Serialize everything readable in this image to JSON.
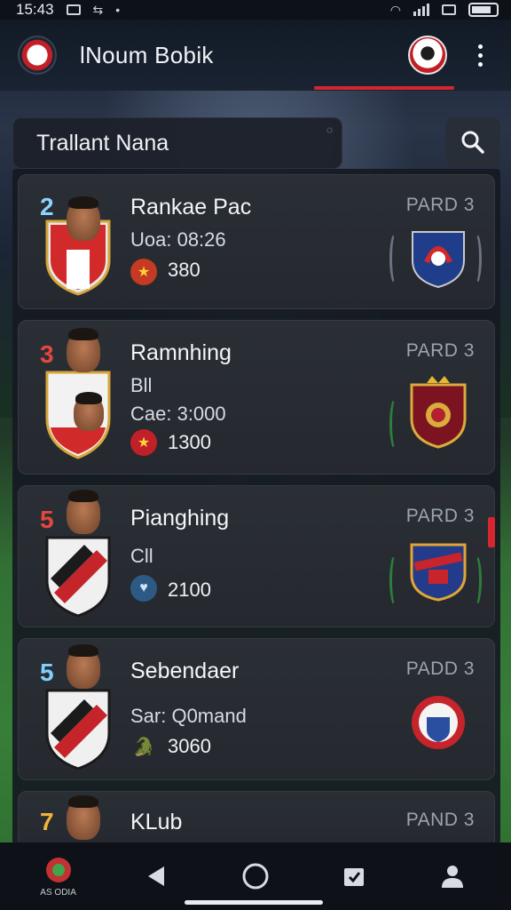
{
  "status_bar": {
    "time": "15:43"
  },
  "header": {
    "title": "lNoum Bobik",
    "menu_icon": "more-vert-icon",
    "avatar_icon": "club-avatar-icon"
  },
  "search": {
    "value": "Trallant Nana",
    "corner_glyph": "◌"
  },
  "players": [
    {
      "rank": "2",
      "rank_color": "#8fd2ff",
      "name": "Rankae Pac",
      "line2": "Uoa: 08:26",
      "points": "380",
      "points_icon_bg": "#c43a22",
      "points_icon": "★",
      "status": "PARD 3"
    },
    {
      "rank": "3",
      "rank_color": "#e5473d",
      "name": "Ramnhing",
      "line2": "Bll",
      "line3": "Cae: 3:000",
      "points": "1300",
      "points_icon_bg": "#c02028",
      "points_icon": "★",
      "status": "PARD 3"
    },
    {
      "rank": "5",
      "rank_color": "#e5473d",
      "name": "Pianghing",
      "line2": "Cll",
      "points": "2100",
      "points_icon_bg": "#2d5a84",
      "points_icon": "♥",
      "status": "PARD 3"
    },
    {
      "rank": "5",
      "rank_color": "#7fd0ff",
      "name": "Sebendaer",
      "line2": "Sar: Q0mand",
      "points": "3060",
      "points_icon_bg": "transparent",
      "points_icon": "🐊",
      "status": "PADD 3"
    },
    {
      "rank": "7",
      "rank_color": "#f0b43a",
      "name": "KLub",
      "status": "PAND 3"
    }
  ],
  "bottom_nav": {
    "home_label": "AS ODIA"
  }
}
